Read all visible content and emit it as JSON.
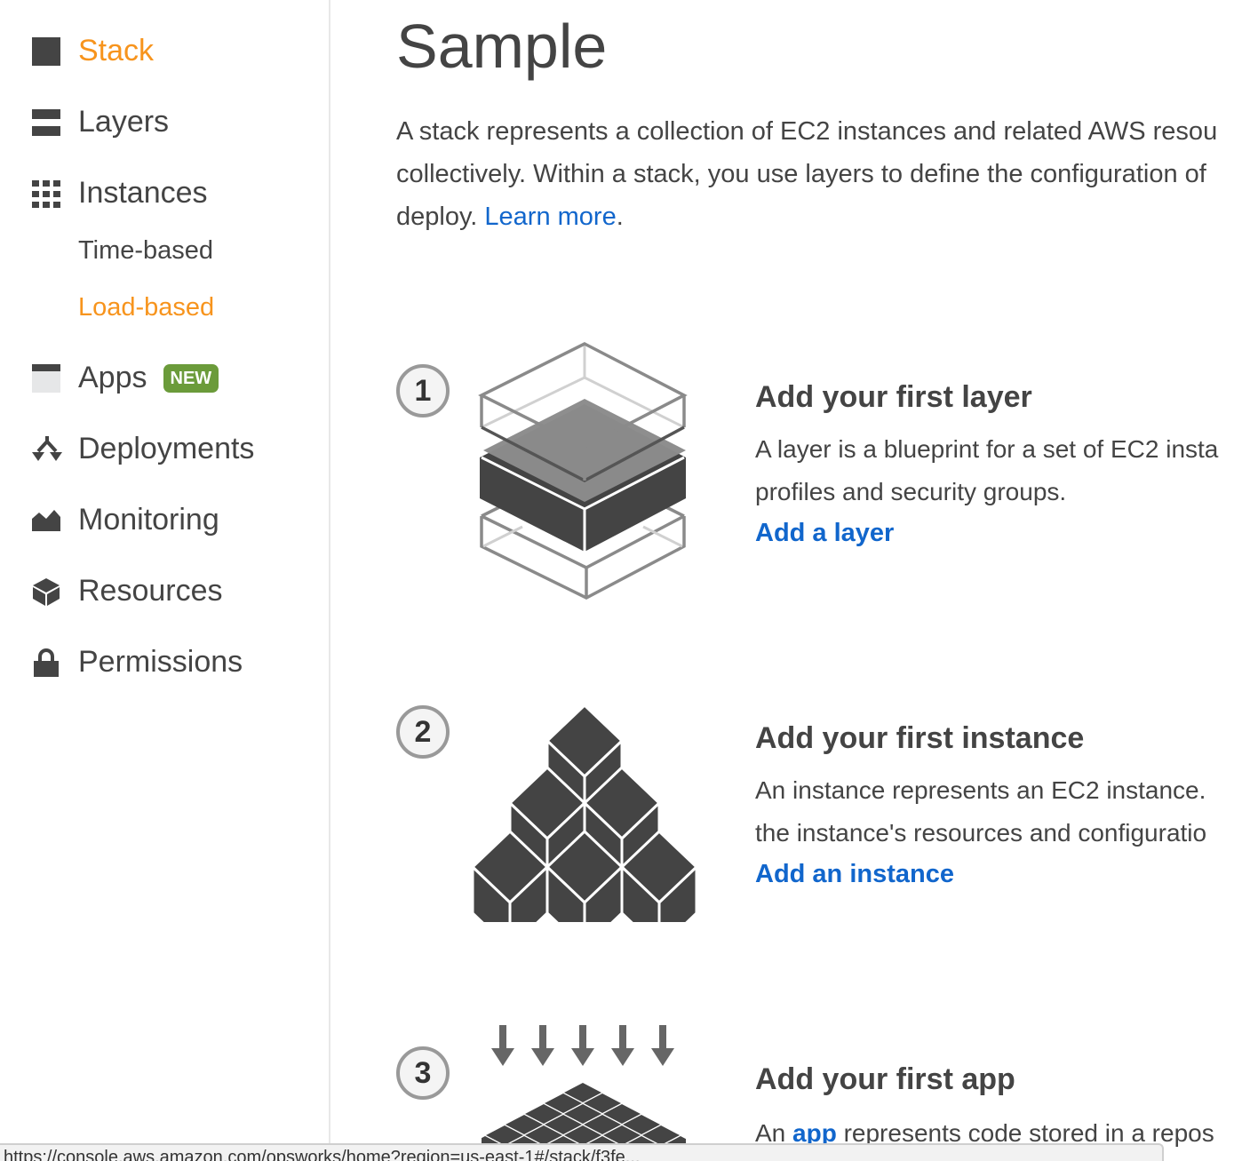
{
  "sidebar": {
    "items": [
      {
        "label": "Stack",
        "icon": "square-icon",
        "active": true
      },
      {
        "label": "Layers",
        "icon": "layers-icon",
        "active": false
      },
      {
        "label": "Instances",
        "icon": "grid-icon",
        "active": false
      },
      {
        "label": "Apps",
        "icon": "app-window-icon",
        "active": false,
        "badge": "NEW"
      },
      {
        "label": "Deployments",
        "icon": "deploy-split-arrows-icon",
        "active": false
      },
      {
        "label": "Monitoring",
        "icon": "area-chart-icon",
        "active": false
      },
      {
        "label": "Resources",
        "icon": "cube-icon",
        "active": false
      },
      {
        "label": "Permissions",
        "icon": "lock-icon",
        "active": false
      }
    ],
    "instances_subitems": [
      {
        "label": "Time-based",
        "active": false
      },
      {
        "label": "Load-based",
        "active": true
      }
    ]
  },
  "colors": {
    "active": "#f7941d",
    "link": "#1166cc",
    "badge": "#6b9b3a",
    "text": "#444444"
  },
  "main": {
    "title": "Sample",
    "intro_line1": "A stack represents a collection of EC2 instances and related AWS resou",
    "intro_line2": "collectively. Within a stack, you use layers to define the configuration of",
    "intro_line3_prefix": "deploy. ",
    "intro_link": "Learn more",
    "intro_suffix": ".",
    "steps": [
      {
        "number": "1",
        "title": "Add your first layer",
        "desc_line1": "A layer is a blueprint for a set of EC2 insta",
        "desc_line2": "profiles and security groups.",
        "action": "Add a layer",
        "illustration": "layers-stack-illustration"
      },
      {
        "number": "2",
        "title": "Add your first instance",
        "desc_line1": "An instance represents an EC2 instance.",
        "desc_line2": "the instance's resources and configuratio",
        "action": "Add an instance",
        "illustration": "cubes-pyramid-illustration"
      },
      {
        "number": "3",
        "title": "Add your first app",
        "desc_prefix": "An ",
        "desc_link": "app",
        "desc_suffix": " represents code stored in a repos",
        "illustration": "arrows-into-grid-illustration"
      }
    ]
  },
  "statusbar": {
    "text": "https://console.aws.amazon.com/opsworks/home?region=us-east-1#/stack/f3fe..."
  }
}
